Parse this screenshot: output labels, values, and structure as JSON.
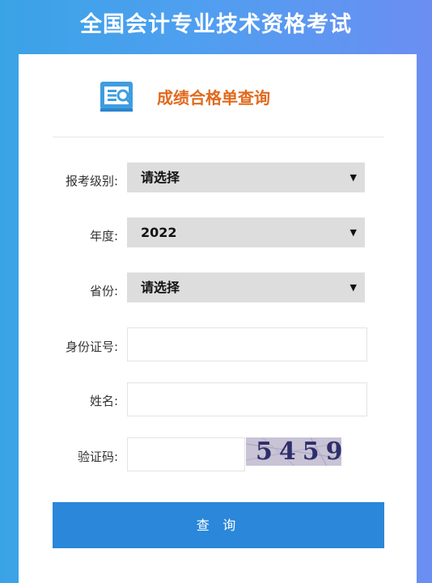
{
  "page": {
    "title": "全国会计专业技术资格考试"
  },
  "card": {
    "heading": "成绩合格单查询",
    "logo_icon": "search-document-icon"
  },
  "form": {
    "exam_level": {
      "label": "报考级别:",
      "value": "请选择",
      "arrow": "▼"
    },
    "year": {
      "label": "年度:",
      "value": "2022",
      "arrow": "▼"
    },
    "province": {
      "label": "省份:",
      "value": "请选择",
      "arrow": "▼"
    },
    "id_number": {
      "label": "身份证号:",
      "value": ""
    },
    "name": {
      "label": "姓名:",
      "value": ""
    },
    "captcha": {
      "label": "验证码:",
      "value": "",
      "image_text": "5459"
    },
    "submit_label": "查 询"
  },
  "colors": {
    "accent": "#2a87d9",
    "heading": "#e06a1e",
    "background_start": "#3aa3e6",
    "background_end": "#6b8ef2"
  }
}
